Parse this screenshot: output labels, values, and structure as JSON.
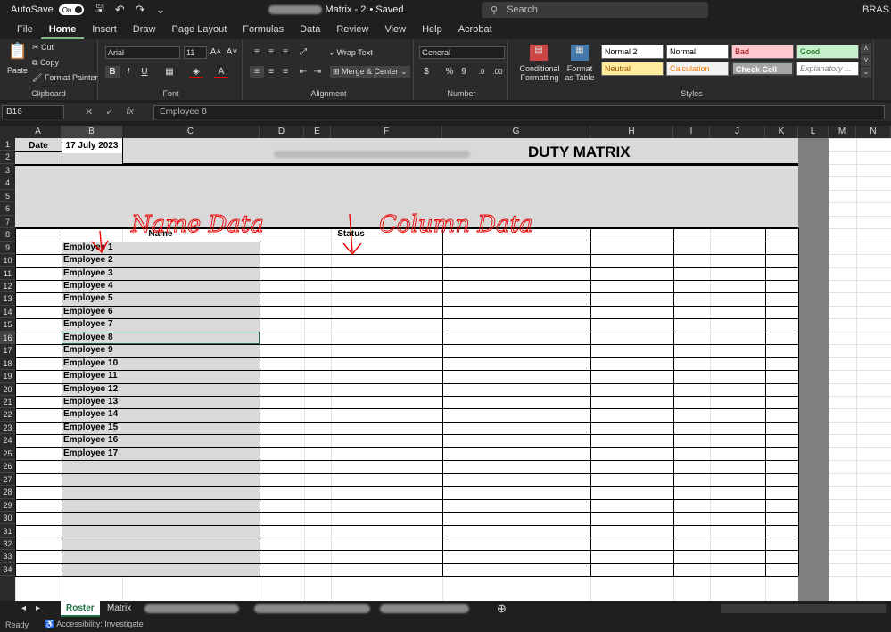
{
  "titlebar": {
    "autosave_label": "AutoSave",
    "toggle_state": "On",
    "file_name": "Matrix - 2",
    "saved_status": "• Saved",
    "search_placeholder": "Search",
    "user": "BRAS"
  },
  "menu_tabs": [
    "File",
    "Home",
    "Insert",
    "Draw",
    "Page Layout",
    "Formulas",
    "Data",
    "Review",
    "View",
    "Help",
    "Acrobat"
  ],
  "active_tab": "Home",
  "ribbon": {
    "clipboard": {
      "paste": "Paste",
      "cut": "Cut",
      "copy": "Copy",
      "format_painter": "Format Painter",
      "label": "Clipboard"
    },
    "font": {
      "font_name": "Arial",
      "font_size": "11",
      "bold": "B",
      "italic": "I",
      "underline": "U",
      "label": "Font"
    },
    "alignment": {
      "wrap_text": "Wrap Text",
      "merge_center": "Merge & Center",
      "label": "Alignment"
    },
    "number": {
      "format": "General",
      "currency": "$",
      "percent": "%",
      "comma": "9",
      "label": "Number"
    },
    "conditional_formatting": "Conditional Formatting",
    "format_as_table": "Format as Table",
    "styles": {
      "label": "Styles",
      "items": [
        "Normal 2",
        "Normal",
        "Bad",
        "Good",
        "Neutral",
        "Calculation",
        "Check Cell",
        "Explanatory ..."
      ]
    }
  },
  "formula_bar": {
    "name_box": "B16",
    "fx": "fx",
    "content": "Employee 8"
  },
  "columns": [
    "A",
    "B",
    "C",
    "D",
    "E",
    "F",
    "G",
    "H",
    "I",
    "J",
    "K",
    "L",
    "M",
    "N"
  ],
  "rows": [
    "1",
    "2",
    "3",
    "4",
    "5",
    "6",
    "7",
    "8",
    "9",
    "10",
    "11",
    "12",
    "13",
    "14",
    "15",
    "16",
    "17",
    "18",
    "19",
    "20",
    "21",
    "22",
    "23",
    "24",
    "25",
    "26",
    "27",
    "28",
    "29",
    "30",
    "31",
    "32",
    "33",
    "34"
  ],
  "sheet": {
    "date_label": "Date",
    "date_value": "17 July 2023",
    "title": "DUTY MATRIX",
    "name_header": "Name",
    "status_header": "Status",
    "employees": [
      "Employee 1",
      "Employee 2",
      "Employee 3",
      "Employee 4",
      "Employee 5",
      "Employee 6",
      "Employee 7",
      "Employee 8",
      "Employee 9",
      "Employee 10",
      "Employee 11",
      "Employee 12",
      "Employee 13",
      "Employee 14",
      "Employee 15",
      "Employee 16",
      "Employee 17"
    ],
    "annotation_left": "Name Data",
    "annotation_right": "Column Data"
  },
  "sheet_tabs": [
    "Roster",
    "Matrix"
  ],
  "active_sheet": "Roster",
  "status_bar": {
    "ready": "Ready",
    "accessibility": "Accessibility: Investigate"
  }
}
